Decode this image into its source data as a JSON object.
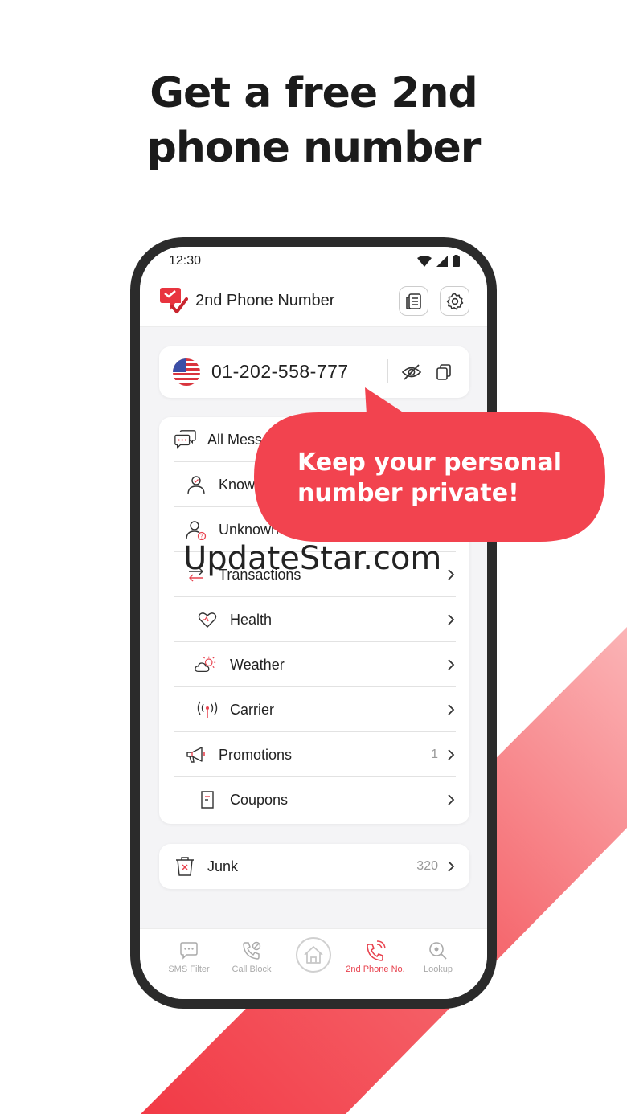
{
  "headline": {
    "line1": "Get a free 2nd",
    "line2": "phone number"
  },
  "colors": {
    "accent": "#e8434f",
    "bubble": "#f2434f",
    "phone_frame": "#2b2b2b"
  },
  "status_bar": {
    "time": "12:30",
    "icons": [
      "wifi-icon",
      "signal-icon",
      "battery-icon"
    ]
  },
  "app_bar": {
    "title": "2nd Phone Number",
    "actions": [
      "notes-icon",
      "gear-icon"
    ]
  },
  "number_card": {
    "flag": "us-flag-icon",
    "number": "01-202-558-777",
    "actions": [
      "hide-eye-icon",
      "copy-icon"
    ]
  },
  "message_categories": [
    {
      "label": "All Messa",
      "icon": "chat-bubbles-icon",
      "count": ""
    },
    {
      "label": "Know",
      "icon": "person-icon",
      "count": ""
    },
    {
      "label": "Unknown",
      "icon": "unknown-person-icon",
      "count": ""
    },
    {
      "label": "Transactions",
      "icon": "transfer-arrows-icon",
      "count": ""
    },
    {
      "label": "Health",
      "icon": "heart-icon",
      "count": ""
    },
    {
      "label": "Weather",
      "icon": "sun-cloud-icon",
      "count": ""
    },
    {
      "label": "Carrier",
      "icon": "antenna-icon",
      "count": ""
    },
    {
      "label": "Promotions",
      "icon": "megaphone-icon",
      "count": "1"
    },
    {
      "label": "Coupons",
      "icon": "coupon-icon",
      "count": ""
    }
  ],
  "junk": {
    "label": "Junk",
    "count": "320",
    "icon": "trash-icon"
  },
  "callout": {
    "line1": "Keep your personal",
    "line2": "number private!"
  },
  "watermark": "UpdateStar.com",
  "bottom_nav": [
    {
      "label": "SMS Filter",
      "icon": "sms-icon",
      "active": false
    },
    {
      "label": "Call Block",
      "icon": "phone-block-icon",
      "active": false
    },
    {
      "label": "",
      "icon": "home-icon",
      "active": false
    },
    {
      "label": "2nd Phone No.",
      "icon": "phone-ring-icon",
      "active": true
    },
    {
      "label": "Lookup",
      "icon": "search-icon",
      "active": false
    }
  ]
}
